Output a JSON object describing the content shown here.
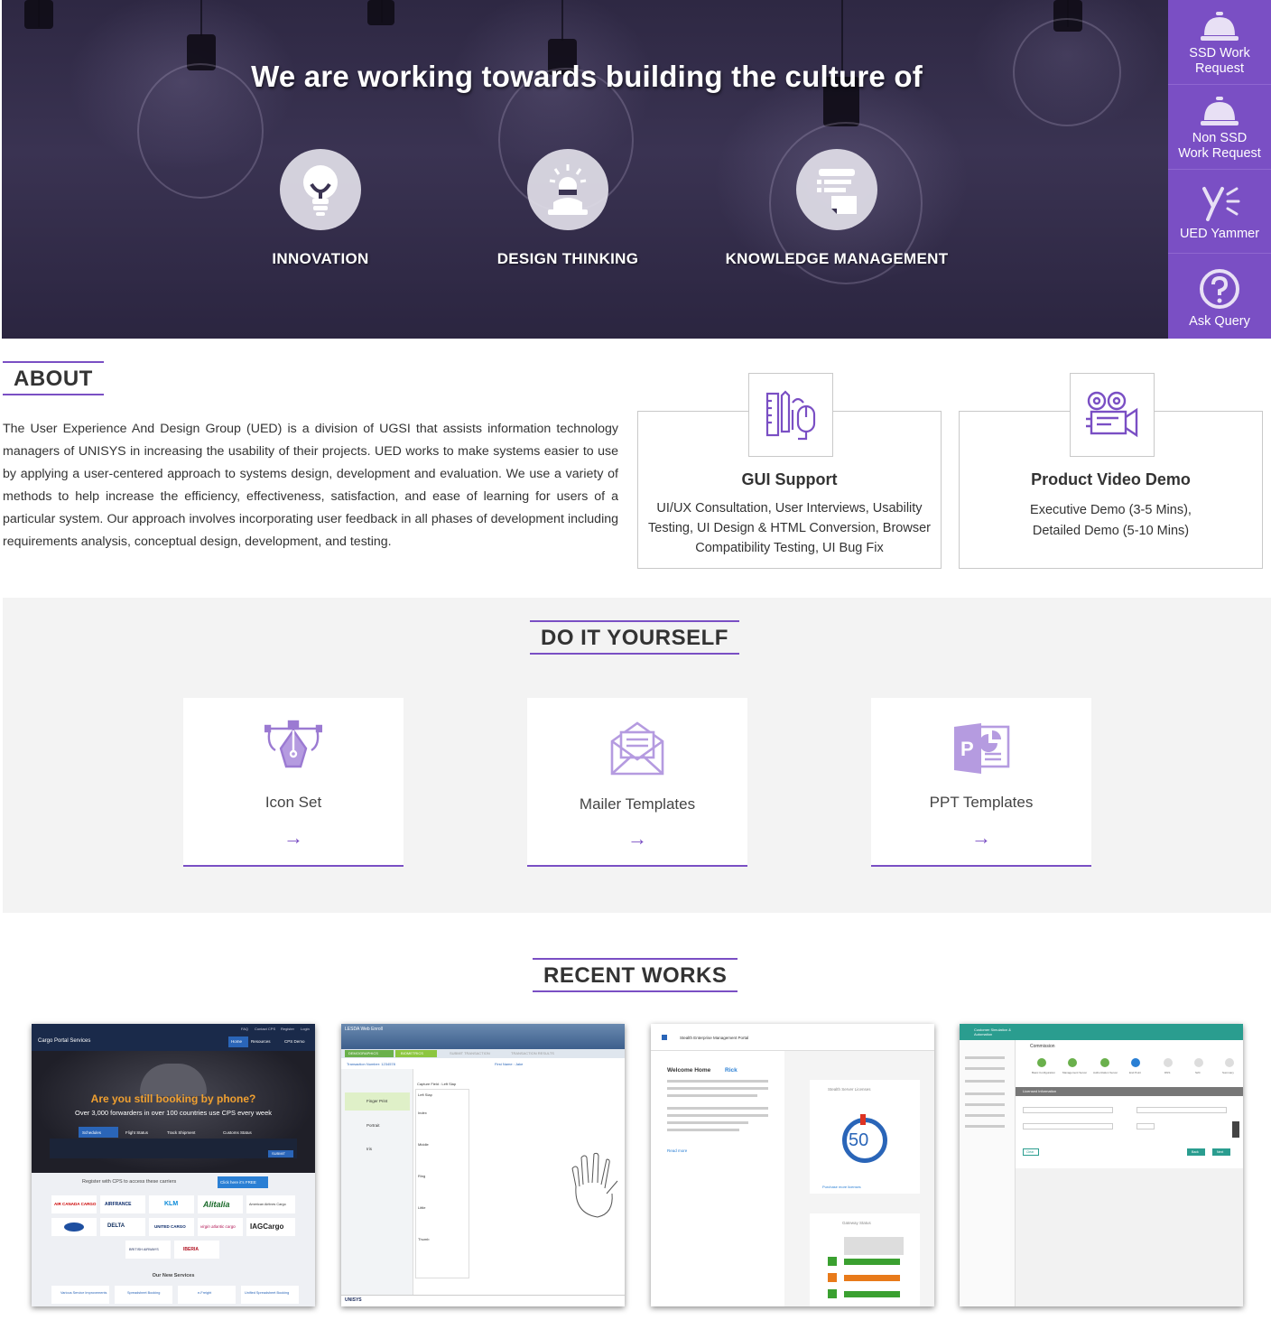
{
  "hero": {
    "title": "We are working towards building the culture of",
    "pillars": [
      {
        "label": "INNOVATION",
        "icon": "lightbulb-icon"
      },
      {
        "label": "DESIGN THINKING",
        "icon": "thinker-icon"
      },
      {
        "label": "KNOWLEDGE MANAGEMENT",
        "icon": "documents-icon"
      }
    ]
  },
  "sidenav": {
    "items": [
      {
        "label_line1": "SSD Work",
        "label_line2": "Request",
        "icon": "service-bell-icon"
      },
      {
        "label_line1": "Non SSD",
        "label_line2": "Work Request",
        "icon": "service-bell-icon"
      },
      {
        "label_line1": "UED Yammer",
        "label_line2": "",
        "icon": "yammer-icon"
      },
      {
        "label_line1": "Ask Query",
        "label_line2": "",
        "icon": "question-icon"
      }
    ],
    "color": "#7a4fc4"
  },
  "about": {
    "heading": "ABOUT",
    "text": "The User Experience And Design Group (UED) is a division of UGSI that assists information technology managers of UNISYS in increasing the usability of their projects. UED works to make systems easier to use by applying a user-centered approach to systems design, development and evaluation. We use a variety of methods to help increase the efficiency, effectiveness, satisfaction, and ease of learning for users of a particular system. Our approach involves incorporating user feedback in all phases of development including requirements analysis, conceptual design, development, and testing.",
    "services": [
      {
        "title": "GUI Support",
        "desc": "UI/UX Consultation, User Interviews, Usability Testing, UI Design & HTML Conversion, Browser Compatibility Testing, UI Bug Fix",
        "icon": "design-tools-icon"
      },
      {
        "title": "Product Video Demo",
        "desc_line1": "Executive Demo (3-5 Mins),",
        "desc_line2": "Detailed Demo (5-10 Mins)",
        "icon": "video-camera-icon"
      }
    ]
  },
  "diy": {
    "heading": "DO IT YOURSELF",
    "cards": [
      {
        "label": "Icon Set",
        "icon": "pen-tool-icon"
      },
      {
        "label": "Mailer Templates",
        "icon": "envelope-icon"
      },
      {
        "label": "PPT Templates",
        "icon": "powerpoint-icon"
      }
    ],
    "arrow": "→"
  },
  "recent": {
    "heading": "RECENT WORKS",
    "works": [
      {
        "name": "cargo-portal",
        "brand": "Cargo Portal Services",
        "topnav": [
          "FAQ",
          "Contact CPS",
          "Register",
          "Login"
        ],
        "nav": [
          "Home",
          "Resources",
          "CPS Demo"
        ],
        "headline": "Are you still booking by phone?",
        "sub": "Over 3,000 forwarders in over 100 countries use CPS every week",
        "tabs": [
          "Schedules",
          "Flight Status",
          "Track Shipment",
          "Customs Status"
        ],
        "search_button": "SUBMIT",
        "register": "Register with CPS to access these carriers",
        "register_button": "Click here it's FREE",
        "carriers": [
          "AIR CANADA CARGO",
          "AIRFRANCE",
          "KLM",
          "Alitalia",
          "American Airlines Cargo",
          "",
          "DELTA",
          "UNITED CARGO",
          "virgin atlantic cargo",
          "IAGCargo",
          "BRITISH AIRWAYS",
          "IBERIA"
        ],
        "services_title": "Our New Services",
        "services": [
          "Various Service Improvements",
          "Spreadsheet Booking",
          "e-Freight",
          "Unified Spreadsheet Booking"
        ]
      },
      {
        "name": "lesda-web-enroll",
        "title": "LESDA Web Enroll",
        "steps": [
          "DEMOGRAPHICS",
          "BIOMETRICS",
          "SUBMIT TRANSACTION",
          "TRANSACTION RESULTS"
        ],
        "transaction": "Transaction Number: 1234578",
        "capture_field": "Capture Field : Left Slap",
        "first_name": "First Name : Jake",
        "side": [
          "Finger Print",
          "Portrait",
          "Iris"
        ],
        "fingers": [
          "Left Slap",
          "Index",
          "Middle",
          "Ring",
          "Little",
          "Thumb"
        ],
        "footer": "UNISYS"
      },
      {
        "name": "stealth-portal",
        "title": "Stealth Enterprise Management Portal",
        "welcome": "Welcome Home",
        "user": "Rick",
        "panel1": "Stealth Server Licenses",
        "gauge_value": "50",
        "panel2": "Gateway Status",
        "link": "Purchase more licenses",
        "read_more": "Read more"
      },
      {
        "name": "customer-simulation",
        "title": "Customer Simulation & Automation",
        "section": "Commission",
        "steps": [
          "Basic Configuration",
          "Management Server",
          "Authorization Server",
          "End Point",
          "DNS",
          "S2C",
          "Summary"
        ],
        "form_title": "Licensed Information",
        "buttons": [
          "Clear",
          "Back",
          "Next"
        ]
      }
    ]
  }
}
